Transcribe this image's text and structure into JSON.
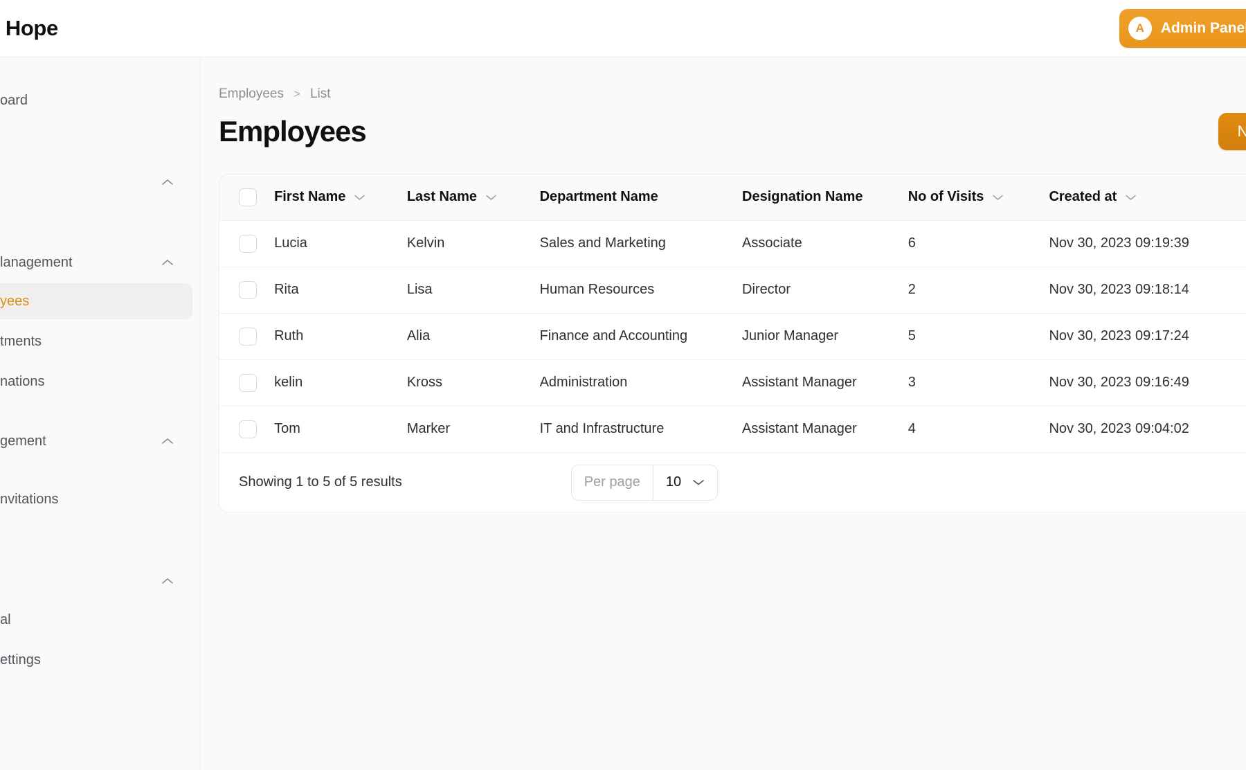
{
  "brand": {
    "name": "sk Hope"
  },
  "topbar": {
    "admin_button": {
      "label": "Admin Panel",
      "avatar_initial": "A",
      "color": "#ed9121"
    }
  },
  "sidebar": {
    "items": [
      {
        "type": "item",
        "label": "oard",
        "active": false
      },
      {
        "type": "spacer_lg"
      },
      {
        "type": "section",
        "label": "",
        "collapsed": false
      },
      {
        "type": "spacer_lg"
      },
      {
        "type": "section",
        "label": "lanagement",
        "collapsed": false
      },
      {
        "type": "item",
        "label": "yees",
        "active": true
      },
      {
        "type": "item",
        "label": "tments",
        "active": false
      },
      {
        "type": "item",
        "label": "nations",
        "active": false
      },
      {
        "type": "spacer_sm"
      },
      {
        "type": "section",
        "label": "gement",
        "collapsed": false
      },
      {
        "type": "spacer_sm"
      },
      {
        "type": "item",
        "label": "nvitations",
        "active": false
      },
      {
        "type": "spacer_lg"
      },
      {
        "type": "section",
        "label": "",
        "collapsed": false
      },
      {
        "type": "item",
        "label": "al",
        "active": false
      },
      {
        "type": "item",
        "label": "ettings",
        "active": false
      }
    ]
  },
  "breadcrumb": {
    "root": "Employees",
    "separator": ">",
    "current": "List"
  },
  "page": {
    "title": "Employees",
    "new_button": "New e"
  },
  "table": {
    "columns": [
      {
        "key": "check",
        "label": "",
        "sortable": false
      },
      {
        "key": "first",
        "label": "First Name",
        "sortable": true
      },
      {
        "key": "last",
        "label": "Last Name",
        "sortable": true
      },
      {
        "key": "dept",
        "label": "Department Name",
        "sortable": false
      },
      {
        "key": "desig",
        "label": "Designation Name",
        "sortable": false
      },
      {
        "key": "visits",
        "label": "No of Visits",
        "sortable": true
      },
      {
        "key": "created",
        "label": "Created at",
        "sortable": true
      }
    ],
    "rows": [
      {
        "first": "Lucia",
        "last": "Kelvin",
        "dept": "Sales and Marketing",
        "desig": "Associate",
        "visits": "6",
        "created": "Nov 30, 2023 09:19:39"
      },
      {
        "first": "Rita",
        "last": "Lisa",
        "dept": "Human Resources",
        "desig": "Director",
        "visits": "2",
        "created": "Nov 30, 2023 09:18:14"
      },
      {
        "first": "Ruth",
        "last": "Alia",
        "dept": "Finance and Accounting",
        "desig": "Junior Manager",
        "visits": "5",
        "created": "Nov 30, 2023 09:17:24"
      },
      {
        "first": "kelin",
        "last": "Kross",
        "dept": "Administration",
        "desig": "Assistant Manager",
        "visits": "3",
        "created": "Nov 30, 2023 09:16:49"
      },
      {
        "first": "Tom",
        "last": "Marker",
        "dept": "IT and Infrastructure",
        "desig": "Assistant Manager",
        "visits": "4",
        "created": "Nov 30, 2023 09:04:02"
      }
    ],
    "footer": {
      "showing": "Showing 1 to 5 of 5 results",
      "per_page_label": "Per page",
      "per_page_value": "10"
    }
  }
}
